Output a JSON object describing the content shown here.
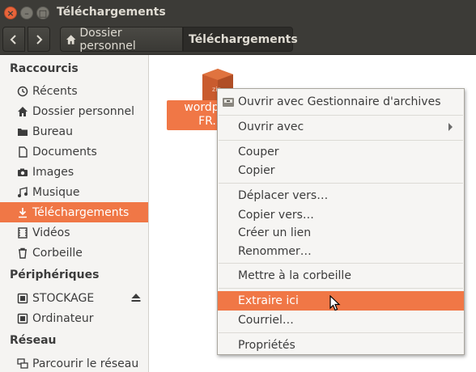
{
  "window": {
    "title": "Téléchargements"
  },
  "toolbar": {
    "breadcrumb_home": "Dossier personnel",
    "breadcrumb_current": "Téléchargements"
  },
  "sidebar": {
    "sections": {
      "shortcuts": "Raccourcis",
      "devices": "Périphériques",
      "network": "Réseau"
    },
    "shortcuts": [
      {
        "label": "Récents",
        "icon": "clock-icon"
      },
      {
        "label": "Dossier personnel",
        "icon": "home-icon"
      },
      {
        "label": "Bureau",
        "icon": "folder-icon"
      },
      {
        "label": "Documents",
        "icon": "document-icon"
      },
      {
        "label": "Images",
        "icon": "camera-icon"
      },
      {
        "label": "Musique",
        "icon": "music-icon"
      },
      {
        "label": "Téléchargements",
        "icon": "download-icon",
        "active": true
      },
      {
        "label": "Vidéos",
        "icon": "film-icon"
      },
      {
        "label": "Corbeille",
        "icon": "trash-icon"
      }
    ],
    "devices": [
      {
        "label": "STOCKAGE",
        "icon": "drive-icon",
        "eject": true
      },
      {
        "label": "Ordinateur",
        "icon": "drive-icon"
      }
    ],
    "network": [
      {
        "label": "Parcourir le réseau",
        "icon": "network-icon"
      }
    ]
  },
  "main": {
    "file": {
      "label_line1": "wordpre",
      "label_line2": "FR.",
      "icon": "zip-archive-icon",
      "icon_text": "zip"
    }
  },
  "context_menu": {
    "items": {
      "open_archive": "Ouvrir avec Gestionnaire d'archives",
      "open_with": "Ouvrir avec",
      "cut": "Couper",
      "copy": "Copier",
      "move_to": "Déplacer vers…",
      "copy_to": "Copier vers…",
      "create_link": "Créer un lien",
      "rename": "Renommer…",
      "trash": "Mettre à la corbeille",
      "extract_here": "Extraire ici",
      "email": "Courriel…",
      "properties": "Propriétés"
    },
    "highlighted": "extract_here"
  },
  "colors": {
    "accent": "#f07746",
    "titlebar": "#3c3b37",
    "sidebar_bg": "#f5f4f2",
    "menu_bg": "#f6f5f3"
  }
}
